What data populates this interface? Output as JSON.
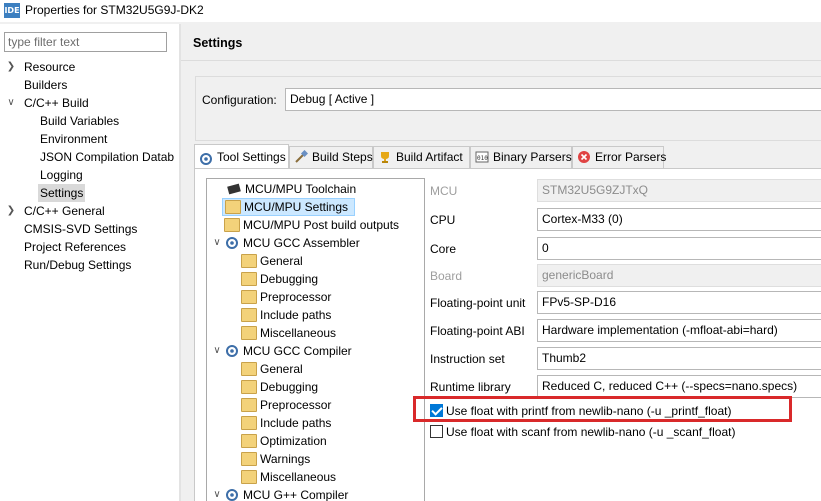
{
  "window": {
    "app_icon_text": "IDE",
    "title": "Properties for STM32U5G9J-DK2"
  },
  "filter": {
    "placeholder": "type filter text"
  },
  "nav": {
    "items": [
      {
        "label": "Resource"
      },
      {
        "label": "Builders"
      },
      {
        "label": "C/C++ Build"
      },
      {
        "label": "Build Variables"
      },
      {
        "label": "Environment"
      },
      {
        "label": "JSON Compilation Datab"
      },
      {
        "label": "Logging"
      },
      {
        "label": "Settings"
      },
      {
        "label": "C/C++ General"
      },
      {
        "label": "CMSIS-SVD Settings"
      },
      {
        "label": "Project References"
      },
      {
        "label": "Run/Debug Settings"
      }
    ]
  },
  "page": {
    "title": "Settings"
  },
  "configuration": {
    "label": "Configuration:",
    "value": "Debug  [ Active ]"
  },
  "tabs": [
    {
      "label": "Tool Settings"
    },
    {
      "label": "Build Steps"
    },
    {
      "label": "Build Artifact"
    },
    {
      "label": "Binary Parsers"
    },
    {
      "label": "Error Parsers"
    }
  ],
  "tree": {
    "items": [
      {
        "label": "MCU/MPU Toolchain",
        "icon": "chip-icon"
      },
      {
        "label": "MCU/MPU Settings",
        "icon": "folder-settings-icon"
      },
      {
        "label": "MCU/MPU Post build outputs",
        "icon": "folder-settings-icon"
      },
      {
        "label": "MCU GCC Assembler",
        "icon": "gear-icon"
      },
      {
        "label": "General",
        "icon": "folder-settings-icon"
      },
      {
        "label": "Debugging",
        "icon": "folder-settings-icon"
      },
      {
        "label": "Preprocessor",
        "icon": "folder-settings-icon"
      },
      {
        "label": "Include paths",
        "icon": "folder-settings-icon"
      },
      {
        "label": "Miscellaneous",
        "icon": "folder-settings-icon"
      },
      {
        "label": "MCU GCC Compiler",
        "icon": "gear-icon"
      },
      {
        "label": "General",
        "icon": "folder-settings-icon"
      },
      {
        "label": "Debugging",
        "icon": "folder-settings-icon"
      },
      {
        "label": "Preprocessor",
        "icon": "folder-settings-icon"
      },
      {
        "label": "Include paths",
        "icon": "folder-settings-icon"
      },
      {
        "label": "Optimization",
        "icon": "folder-settings-icon"
      },
      {
        "label": "Warnings",
        "icon": "folder-settings-icon"
      },
      {
        "label": "Miscellaneous",
        "icon": "folder-settings-icon"
      },
      {
        "label": "MCU G++ Compiler",
        "icon": "gear-icon"
      }
    ]
  },
  "properties": {
    "mcu": {
      "label": "MCU",
      "value": "STM32U5G9ZJTxQ"
    },
    "cpu": {
      "label": "CPU",
      "value": "Cortex-M33 (0)"
    },
    "core": {
      "label": "Core",
      "value": "0"
    },
    "board": {
      "label": "Board",
      "value": "genericBoard"
    },
    "fpu": {
      "label": "Floating-point unit",
      "value": "FPv5-SP-D16"
    },
    "fpabi": {
      "label": "Floating-point ABI",
      "value": "Hardware implementation (-mfloat-abi=hard)"
    },
    "iset": {
      "label": "Instruction set",
      "value": "Thumb2"
    },
    "runtime": {
      "label": "Runtime library",
      "value": "Reduced C, reduced C++ (--specs=nano.specs)"
    }
  },
  "checkboxes": {
    "printf": {
      "label": "Use float with printf from newlib-nano (-u _printf_float)",
      "checked": true
    },
    "scanf": {
      "label": "Use float with scanf from newlib-nano (-u _scanf_float)",
      "checked": false
    }
  },
  "colors": {
    "highlight": "#d9292a",
    "accent": "#0078d7",
    "selection": "#cce8ff"
  }
}
